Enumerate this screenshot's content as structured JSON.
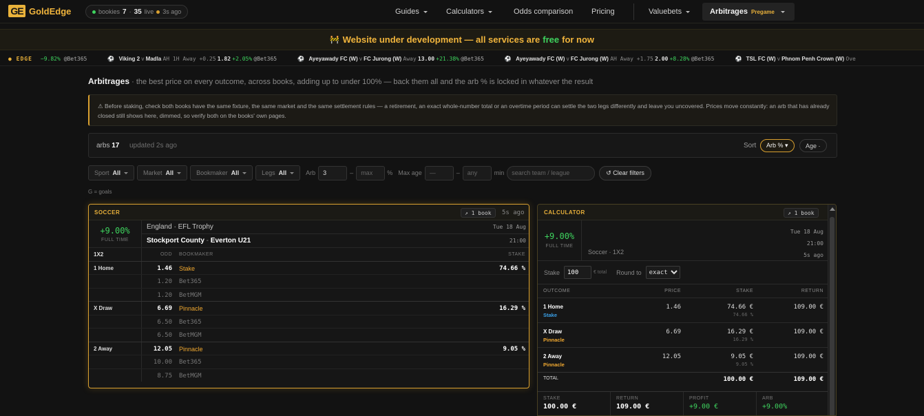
{
  "nav": {
    "logo_mark": "GE",
    "logo_text": "GoldEdge",
    "status": {
      "bookies_label": "bookies",
      "bookies_count": "7",
      "live_count": "35",
      "live_label": "live",
      "updated": "3s ago"
    },
    "menu": [
      {
        "label": "Guides",
        "has_caret": true
      },
      {
        "label": "Calculators",
        "has_caret": true
      },
      {
        "label": "Odds comparison",
        "has_caret": false
      },
      {
        "label": "Pricing",
        "has_caret": false
      },
      {
        "label": "Valuebets",
        "has_caret": true
      }
    ],
    "arbitrages": {
      "label": "Arbitrages",
      "badge": "Pregame"
    }
  },
  "banner": {
    "icon": "🚧",
    "before": "Website under development — all services are",
    "free": "free",
    "after": "for now"
  },
  "ticker": {
    "tag": "● EDGE",
    "items": [
      {
        "prefix": "",
        "home": "",
        "away": "",
        "market": "",
        "odd": "",
        "pct": "−9.82%",
        "book": "@Bet365"
      },
      {
        "prefix": "⚽",
        "home": "Viking 2",
        "away": "Madla",
        "market": "AH 1H Away +0.25",
        "odd": "1.82",
        "pct": "+2.05%",
        "book": "@Bet365"
      },
      {
        "prefix": "⚽",
        "home": "Ayeyawady FC (W)",
        "away": "FC Jurong (W)",
        "market": "Away",
        "odd": "13.00",
        "pct": "+21.38%",
        "book": "@Bet365"
      },
      {
        "prefix": "⚽",
        "home": "Ayeyawady FC (W)",
        "away": "FC Jurong (W)",
        "market": "AH Away +1.75",
        "odd": "2.00",
        "pct": "+8.28%",
        "book": "@Bet365"
      },
      {
        "prefix": "⚽",
        "home": "TSL FC (W)",
        "away": "Phnom Penh Crown (W)",
        "market": "Ove",
        "odd": "",
        "pct": "",
        "book": ""
      }
    ]
  },
  "heading": {
    "title": "Arbitrages",
    "subtitle": "· the best price on every outcome, across books, adding up to under 100% — back them all and the arb % is locked in whatever the result"
  },
  "warning": "⚠ Before staking, check both books have the same fixture, the same market and the same settlement rules — a retirement, an exact whole-number total or an overtime period can settle the two legs differently and leave you uncovered. Prices move constantly: an arb that has already closed still shows here, dimmed, so verify both on the books' own pages.",
  "counter": {
    "label": "arbs",
    "count": "17",
    "updated": "updated 2s ago",
    "sort_label": "Sort",
    "sort_active": "Arb % ▾",
    "sort_other": "Age ·"
  },
  "filters": {
    "sport": {
      "label": "Sport",
      "value": "All"
    },
    "market": {
      "label": "Market",
      "value": "All"
    },
    "bookmaker": {
      "label": "Bookmaker",
      "value": "All"
    },
    "legs": {
      "label": "Legs",
      "value": "All"
    },
    "arb_label": "Arb",
    "arb_min": "3",
    "arb_max_placeholder": "max",
    "pct": "%",
    "max_age_label": "Max age",
    "age_min_placeholder": "—",
    "age_max_placeholder": "any",
    "min_label": "min",
    "search_placeholder": "search team / league",
    "clear": "↺ Clear filters",
    "dash": "–"
  },
  "legend": "G = goals",
  "arb_card": {
    "sport": "SOCCER",
    "books": "↗ 1 book",
    "age": "5s ago",
    "pct": "+9.00%",
    "period": "FULL TIME",
    "league": "England · EFL Trophy",
    "date": "Tue 18 Aug",
    "home": "Stockport County",
    "sep": " - ",
    "away": "Everton U21",
    "time": "21:00",
    "market": "1X2",
    "col_odd": "ODD",
    "col_book": "BOOKMAKER",
    "col_stake": "STAKE",
    "outcomes": [
      {
        "name": "1 Home",
        "rows": [
          {
            "odd": "1.46",
            "book": "Stake",
            "stake": "74.66 %",
            "best": true
          },
          {
            "odd": "1.20",
            "book": "Bet365",
            "stake": "",
            "best": false
          },
          {
            "odd": "1.20",
            "book": "BetMGM",
            "stake": "",
            "best": false
          }
        ]
      },
      {
        "name": "X Draw",
        "rows": [
          {
            "odd": "6.69",
            "book": "Pinnacle",
            "stake": "16.29 %",
            "best": true
          },
          {
            "odd": "6.50",
            "book": "Bet365",
            "stake": "",
            "best": false
          },
          {
            "odd": "6.50",
            "book": "BetMGM",
            "stake": "",
            "best": false
          }
        ]
      },
      {
        "name": "2 Away",
        "rows": [
          {
            "odd": "12.05",
            "book": "Pinnacle",
            "stake": "9.05 %",
            "best": true
          },
          {
            "odd": "10.00",
            "book": "Bet365",
            "stake": "",
            "best": false
          },
          {
            "odd": "8.75",
            "book": "BetMGM",
            "stake": "",
            "best": false
          }
        ]
      }
    ]
  },
  "calculator": {
    "title": "CALCULATOR",
    "books": "↗ 1 book",
    "pct": "+9.00%",
    "period": "FULL TIME",
    "date": "Tue 18 Aug",
    "time": "21:00",
    "age": "5s ago",
    "market": "Soccer · 1X2",
    "stake_label": "Stake",
    "stake_value": "100",
    "stake_unit": "€ total",
    "round_label": "Round to",
    "round_value": "exact",
    "cols": {
      "outcome": "OUTCOME",
      "price": "PRICE",
      "stake": "STAKE",
      "return": "RETURN"
    },
    "rows": [
      {
        "outcome": "1 Home",
        "book": "Stake",
        "book_color": "#3aa0e8",
        "price": "1.46",
        "stake": "74.66 €",
        "stake_pct": "74.66 %",
        "ret": "109.00 €"
      },
      {
        "outcome": "X Draw",
        "book": "Pinnacle",
        "book_color": "#f0a830",
        "price": "6.69",
        "stake": "16.29 €",
        "stake_pct": "16.29 %",
        "ret": "109.00 €"
      },
      {
        "outcome": "2 Away",
        "book": "Pinnacle",
        "book_color": "#f0a830",
        "price": "12.05",
        "stake": "9.05 €",
        "stake_pct": "9.05 %",
        "ret": "109.00 €"
      }
    ],
    "total_label": "TOTAL",
    "total_stake": "100.00 €",
    "total_return": "109.00 €",
    "summary": [
      {
        "k": "STAKE",
        "v": "100.00 €",
        "green": false
      },
      {
        "k": "RETURN",
        "v": "109.00 €",
        "green": false
      },
      {
        "k": "PROFIT",
        "v": "+9.00 €",
        "green": true
      },
      {
        "k": "ARB",
        "v": "+9.00%",
        "green": true
      }
    ]
  }
}
